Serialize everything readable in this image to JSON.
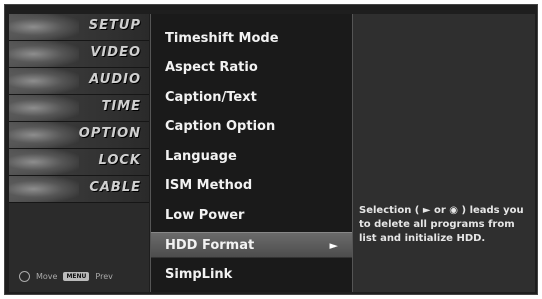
{
  "categories": [
    {
      "label": "SETUP"
    },
    {
      "label": "VIDEO"
    },
    {
      "label": "AUDIO"
    },
    {
      "label": "TIME"
    },
    {
      "label": "OPTION"
    },
    {
      "label": "LOCK"
    },
    {
      "label": "CABLE"
    }
  ],
  "footer": {
    "move_label": "Move",
    "menu_key": "MENU",
    "prev_label": "Prev"
  },
  "options": [
    {
      "label": "Timeshift Mode"
    },
    {
      "label": "Aspect Ratio"
    },
    {
      "label": "Caption/Text"
    },
    {
      "label": "Caption Option"
    },
    {
      "label": "Language"
    },
    {
      "label": "ISM Method"
    },
    {
      "label": "Low Power"
    },
    {
      "label": "HDD Format",
      "arrow": "►"
    },
    {
      "label": "SimpLink"
    }
  ],
  "selected_option": "HDD Format",
  "help": {
    "text": "Selection ( ► or ◉ ) leads you to delete all programs from list and initialize HDD."
  }
}
